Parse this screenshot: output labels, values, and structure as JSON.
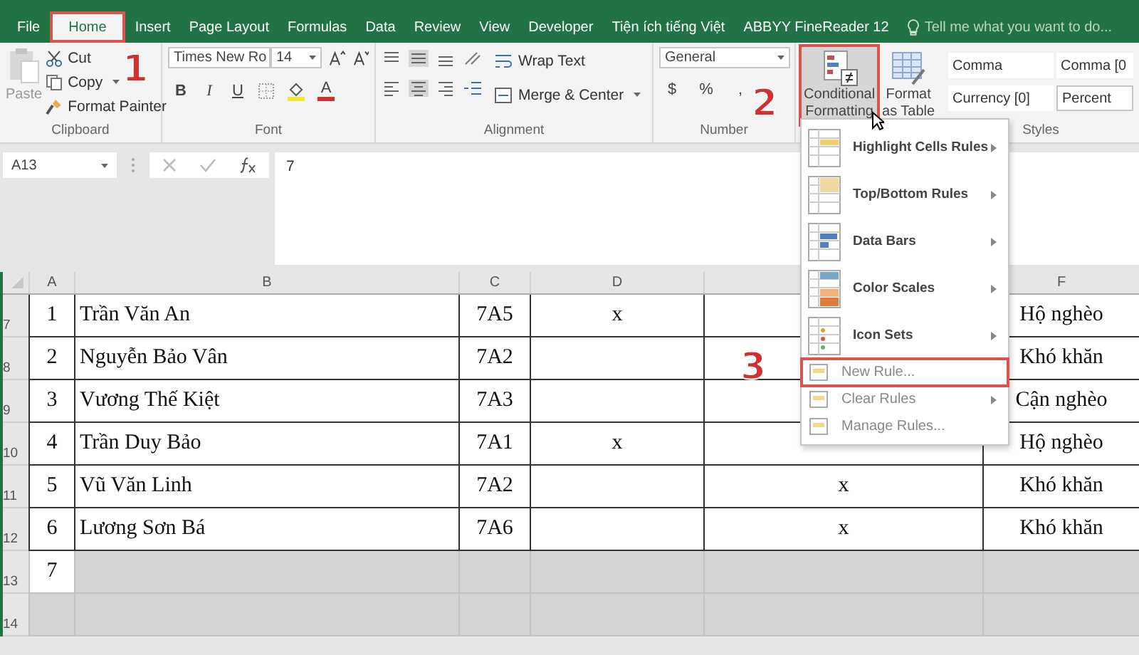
{
  "tabs": [
    {
      "label": "File",
      "selected": false,
      "outlined": false
    },
    {
      "label": "Home",
      "selected": true,
      "outlined": true
    },
    {
      "label": "Insert",
      "selected": false,
      "outlined": false
    },
    {
      "label": "Page Layout",
      "selected": false,
      "outlined": false
    },
    {
      "label": "Formulas",
      "selected": false,
      "outlined": false
    },
    {
      "label": "Data",
      "selected": false,
      "outlined": false
    },
    {
      "label": "Review",
      "selected": false,
      "outlined": false
    },
    {
      "label": "View",
      "selected": false,
      "outlined": false
    },
    {
      "label": "Developer",
      "selected": false,
      "outlined": false
    },
    {
      "label": "Tiện ích tiếng Việt",
      "selected": false,
      "outlined": false
    },
    {
      "label": "ABBYY FineReader 12",
      "selected": false,
      "outlined": false
    }
  ],
  "tell_me": {
    "placeholder": "Tell me what you want to do..."
  },
  "clipboard": {
    "paste": "Paste",
    "cut": "Cut",
    "copy": "Copy",
    "format_painter": "Format Painter",
    "group": "Clipboard"
  },
  "font": {
    "name": "Times New Ro",
    "size": "14",
    "bold": "B",
    "italic": "I",
    "underline": "U",
    "font_color": "A",
    "group": "Font"
  },
  "alignment": {
    "wrap_text": "Wrap Text",
    "merge_center": "Merge & Center",
    "group": "Alignment"
  },
  "number": {
    "format": "General",
    "currency": "$",
    "percent": "%",
    "comma": ",",
    "group": "Number"
  },
  "conditional_formatting": {
    "label": "Conditional Formatting",
    "outlined": true
  },
  "format_as_table": {
    "label": "Format as Table"
  },
  "styles": {
    "items": [
      {
        "label": "Comma",
        "kind": "plain"
      },
      {
        "label": "Comma [0",
        "kind": "plain"
      },
      {
        "label": "Currency [0]",
        "kind": "plain"
      },
      {
        "label": "Percent",
        "kind": "boxed"
      }
    ],
    "group": "Styles"
  },
  "name_box": "A13",
  "formula": "7",
  "columns": [
    {
      "label": "A"
    },
    {
      "label": "B"
    },
    {
      "label": "C"
    },
    {
      "label": "D"
    },
    {},
    {
      "label": "F"
    }
  ],
  "rows": [
    {
      "header": "7",
      "selected": false,
      "cells": [
        "1",
        "Trần Văn An",
        "7A5",
        "x",
        null,
        "Hộ nghèo"
      ]
    },
    {
      "header": "8",
      "selected": false,
      "cells": [
        "2",
        "Nguyễn Bảo Vân",
        "7A2",
        null,
        null,
        "Khó khăn"
      ]
    },
    {
      "header": "9",
      "selected": false,
      "cells": [
        "3",
        "Vương Thế Kiệt",
        "7A3",
        null,
        null,
        "Cận nghèo"
      ]
    },
    {
      "header": "10",
      "selected": false,
      "cells": [
        "4",
        "Trần Duy Bảo",
        "7A1",
        "x",
        null,
        "Hộ nghèo"
      ]
    },
    {
      "header": "11",
      "selected": false,
      "cells": [
        "5",
        "Vũ Văn Linh",
        "7A2",
        null,
        "x",
        "Khó khăn"
      ]
    },
    {
      "header": "12",
      "selected": false,
      "cells": [
        "6",
        "Lương Sơn Bá",
        "7A6",
        null,
        "x",
        "Khó khăn"
      ]
    },
    {
      "header": "13",
      "selected": true,
      "cells": [
        "7"
      ]
    },
    {
      "header": "14",
      "selected": true,
      "cells": []
    }
  ],
  "menu": [
    {
      "label": "Highlight Cells Rules",
      "kind": "large",
      "submenu": true,
      "outlined": false
    },
    {
      "label": "Top/Bottom Rules",
      "kind": "large",
      "submenu": true,
      "outlined": false
    },
    {
      "label": "Data Bars",
      "kind": "large",
      "submenu": true,
      "outlined": false
    },
    {
      "label": "Color Scales",
      "kind": "large",
      "submenu": true,
      "outlined": false
    },
    {
      "label": "Icon Sets",
      "kind": "large",
      "submenu": true,
      "outlined": false
    },
    {
      "label": "New Rule...",
      "kind": "small",
      "submenu": false,
      "outlined": true
    },
    {
      "label": "Clear Rules",
      "kind": "small",
      "submenu": true,
      "outlined": false
    },
    {
      "label": "Manage Rules...",
      "kind": "small",
      "submenu": false,
      "outlined": false
    }
  ],
  "annotations": [
    "1",
    "2",
    "3"
  ]
}
